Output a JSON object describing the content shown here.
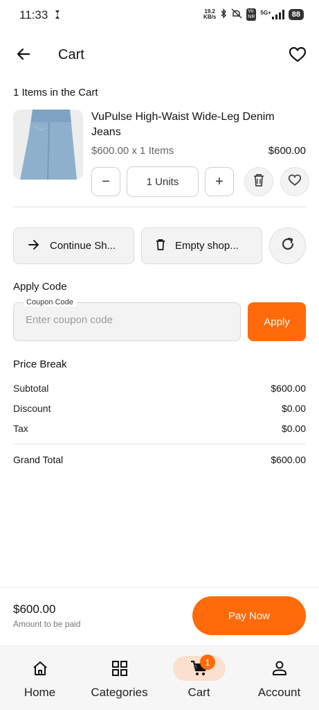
{
  "status_bar": {
    "time": "11:33",
    "net_speed_value": "19.2",
    "net_speed_unit": "KB/s",
    "network": "5G+",
    "battery": "88"
  },
  "header": {
    "title": "Cart",
    "back_icon": "arrow-left-icon",
    "wishlist_icon": "heart-icon"
  },
  "cart": {
    "items_count_label": "1 Items in the Cart",
    "items": [
      {
        "name": "VuPulse High-Waist Wide-Leg Denim Jeans",
        "price_line": "$600.00 x 1 Items",
        "total": "$600.00",
        "quantity_label": "1 Units",
        "decrement_label": "−",
        "increment_label": "+"
      }
    ]
  },
  "actions": {
    "continue_label": "Continue Sh...",
    "empty_label": "Empty shop...",
    "refresh_icon": "refresh-icon"
  },
  "coupon": {
    "section_title": "Apply Code",
    "field_label": "Coupon Code",
    "placeholder": "Enter coupon code",
    "value": "",
    "apply_label": "Apply"
  },
  "price_break": {
    "title": "Price Break",
    "rows": [
      {
        "label": "Subtotal",
        "value": "$600.00"
      },
      {
        "label": "Discount",
        "value": "$0.00"
      },
      {
        "label": "Tax",
        "value": "$0.00"
      }
    ],
    "grand_total_label": "Grand Total",
    "grand_total_value": "$600.00"
  },
  "payment": {
    "amount": "$600.00",
    "amount_caption": "Amount to be paid",
    "pay_label": "Pay Now"
  },
  "bottom_nav": {
    "items": [
      {
        "label": "Home",
        "icon": "home-icon"
      },
      {
        "label": "Categories",
        "icon": "grid-icon"
      },
      {
        "label": "Cart",
        "icon": "cart-icon",
        "badge": "1",
        "active": true
      },
      {
        "label": "Account",
        "icon": "person-icon"
      }
    ]
  },
  "colors": {
    "accent": "#ff6a0a",
    "active_nav_bg": "#fbe0cf"
  }
}
